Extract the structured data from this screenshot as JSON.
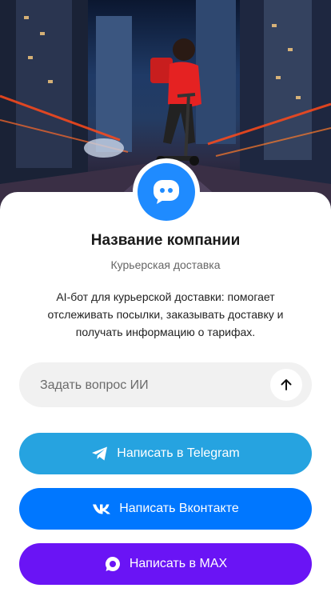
{
  "company": {
    "name": "Название компании",
    "category": "Курьерская доставка",
    "description": "AI-бот для курьерской доставки: помогает отслеживать посылки, заказывать доставку и получать информацию о тарифах."
  },
  "ask": {
    "placeholder": "Задать вопрос ИИ"
  },
  "buttons": {
    "telegram": "Написать в Telegram",
    "vk": "Написать Вконтакте",
    "max": "Написать в MAX"
  },
  "icons": {
    "avatar": "chat-bubble-icon",
    "send": "arrow-up-icon",
    "telegram": "telegram-icon",
    "vk": "vk-icon",
    "max": "max-icon"
  },
  "colors": {
    "avatar": "#1f8bff",
    "telegram": "#26a3e0",
    "vk": "#0077ff",
    "max": "#6a14f5"
  }
}
